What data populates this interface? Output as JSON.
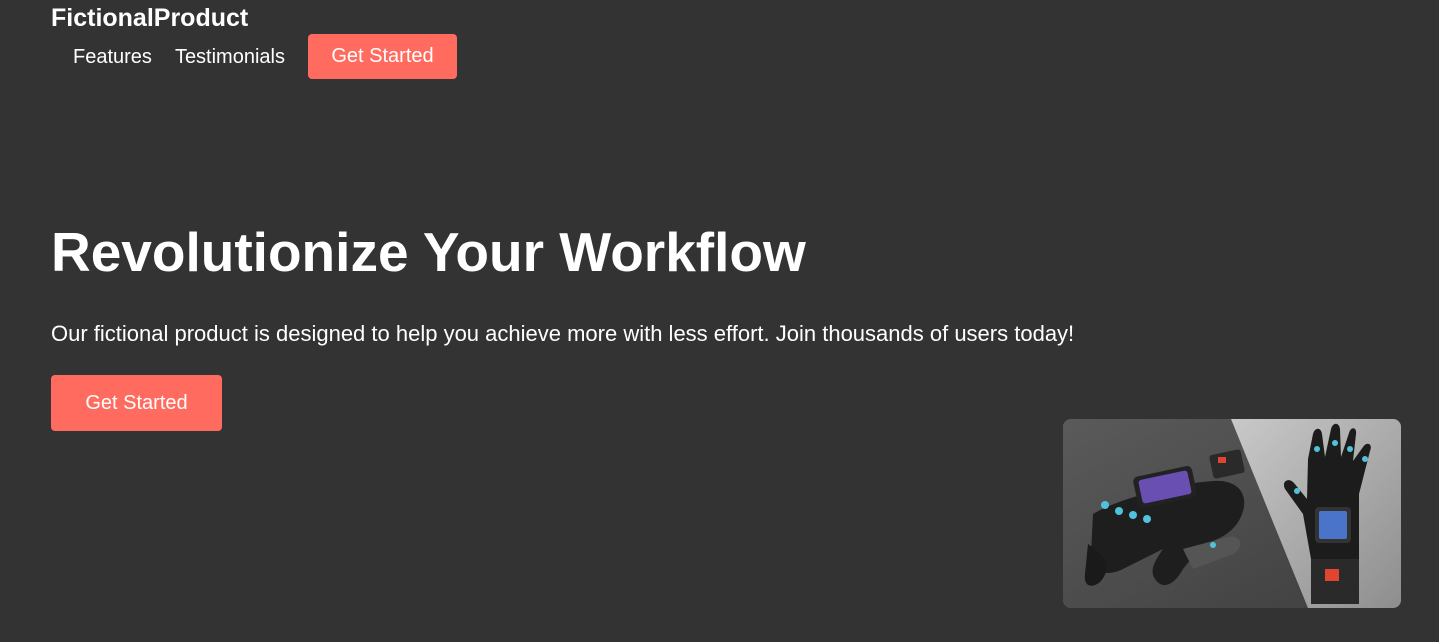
{
  "header": {
    "brand": "FictionalProduct",
    "nav": {
      "features_label": "Features",
      "testimonials_label": "Testimonials",
      "cta_label": "Get Started"
    }
  },
  "hero": {
    "title": "Revolutionize Your Workflow",
    "subtitle": "Our fictional product is designed to help you achieve more with less effort. Join thousands of users today!",
    "cta_label": "Get Started"
  },
  "product_image": {
    "icon": "smart-glove-image"
  },
  "colors": {
    "background": "#333333",
    "accent": "#ff6b5e",
    "text": "#ffffff"
  }
}
